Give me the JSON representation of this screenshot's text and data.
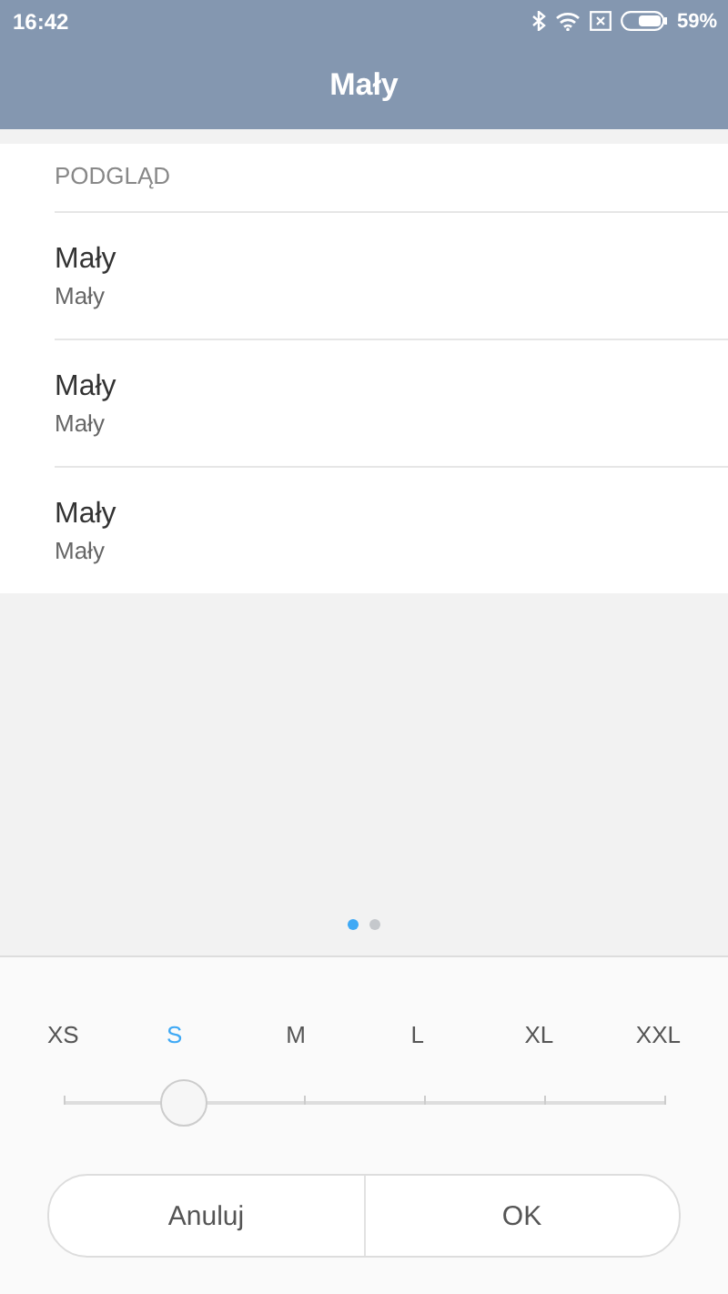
{
  "status_bar": {
    "time": "16:42",
    "battery": "59%"
  },
  "title": "Mały",
  "preview": {
    "header": "PODGLĄD",
    "items": [
      {
        "title": "Mały",
        "subtitle": "Mały"
      },
      {
        "title": "Mały",
        "subtitle": "Mały"
      },
      {
        "title": "Mały",
        "subtitle": "Mały"
      }
    ]
  },
  "page_dots": [
    {
      "selected": true
    },
    {
      "selected": false
    }
  ],
  "sizes": [
    {
      "label": "XS",
      "selected": false
    },
    {
      "label": "S",
      "selected": true
    },
    {
      "label": "M",
      "selected": false
    },
    {
      "label": "L",
      "selected": false
    },
    {
      "label": "XL",
      "selected": false
    },
    {
      "label": "XXL",
      "selected": false
    }
  ],
  "slider": {
    "level": 0.2
  },
  "buttons": [
    "Anuluj",
    "OK"
  ]
}
